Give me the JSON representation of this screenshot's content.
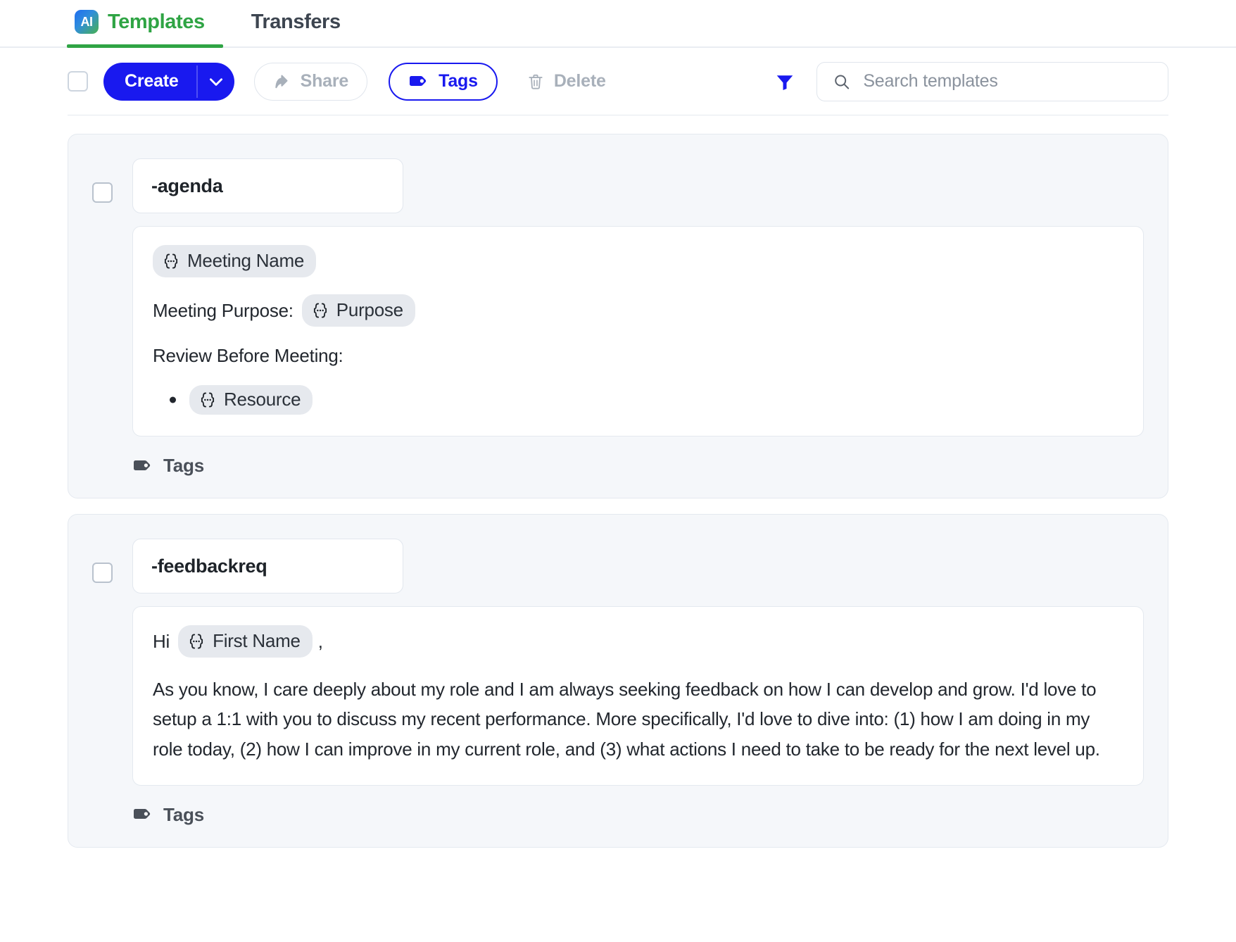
{
  "tabs": [
    {
      "label": "Templates",
      "badge": "AI",
      "active": true
    },
    {
      "label": "Transfers",
      "badge": "",
      "active": false
    }
  ],
  "toolbar": {
    "select_all_checkbox": "",
    "create_label": "Create",
    "create_caret_icon": "chevron-down-icon",
    "share_label": "Share",
    "share_icon": "share-arrow-icon",
    "tags_label": "Tags",
    "tags_icon": "tag-icon",
    "delete_label": "Delete",
    "delete_icon": "trash-icon",
    "filter_icon": "filter-funnel-icon",
    "search": {
      "icon": "search-icon",
      "placeholder": "Search templates",
      "value": ""
    }
  },
  "colors": {
    "accent_blue": "#1919EF",
    "accent_green": "#2FA444",
    "muted_gray": "#A8B0BA",
    "card_bg": "#F5F7FA",
    "chip_bg": "#E6E9EE"
  },
  "templates": [
    {
      "shortcut": "-agenda",
      "tags_label": "Tags",
      "tags_icon": "tag-icon",
      "content": {
        "line1_chip": "Meeting Name",
        "line2_prefix": "Meeting Purpose:",
        "line2_chip": "Purpose",
        "line3_text": "Review Before Meeting:",
        "bullet1_chip": "Resource"
      }
    },
    {
      "shortcut": "-feedbackreq",
      "tags_label": "Tags",
      "tags_icon": "tag-icon",
      "content": {
        "greeting_prefix": "Hi",
        "greeting_chip": "First Name",
        "greeting_suffix": ",",
        "paragraph": "As you know, I care deeply about my role and I am always seeking feedback on how I can develop and grow. I'd love to setup a 1:1 with you to discuss my recent performance. More specifically, I'd love to dive into: (1) how I am doing in my role today, (2) how I can improve in my current role, and (3) what actions I need to take to be ready for the next level up."
      }
    }
  ]
}
